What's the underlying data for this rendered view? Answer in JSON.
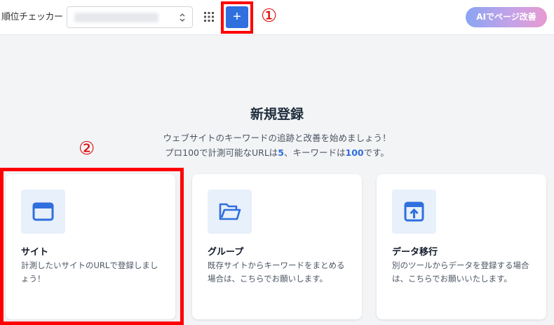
{
  "header": {
    "logo": "順位チェッカー",
    "site_select_value": "",
    "add_label": "+",
    "ai_button_label": "AIでページ改善"
  },
  "annotations": {
    "marker_1": "①",
    "marker_2": "②"
  },
  "intro": {
    "title": "新規登録",
    "line1": "ウェブサイトのキーワードの追跡と改善を始めましょう！",
    "line2_part1": "プロ100で計測可能なURLは",
    "line2_url_count": "5",
    "line2_part2": "、キーワードは",
    "line2_keyword_count": "100",
    "line2_part3": "です。"
  },
  "cards": [
    {
      "icon": "browser-window-icon",
      "title": "サイト",
      "description": "計測したいサイトのURLで登録しましょう！"
    },
    {
      "icon": "folder-open-icon",
      "title": "グループ",
      "description": "既存サイトからキーワードをまとめる場合は、こちらでお願いします。"
    },
    {
      "icon": "upload-box-icon",
      "title": "データ移行",
      "description": "別のツールからデータを登録する場合は、こちらでお願いいたします。"
    }
  ],
  "colors": {
    "accent": "#2f6fde",
    "highlight": "#ff0000",
    "icon_bg": "#e8f0fb"
  }
}
